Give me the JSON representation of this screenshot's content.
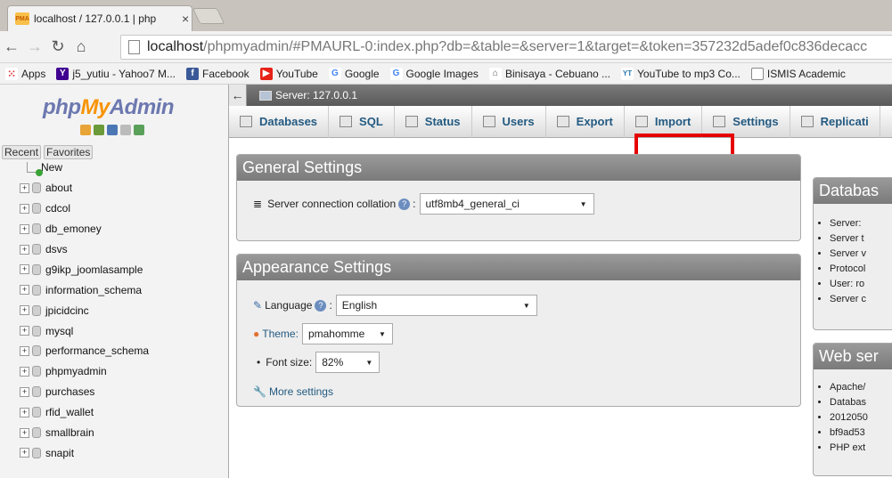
{
  "browser": {
    "tab_title": "localhost / 127.0.0.1 | php",
    "tab_close": "×",
    "url_host": "localhost",
    "url_path": "/phpmyadmin/#PMAURL-0:index.php?db=&table=&server=1&target=&token=357232d5adef0c836decacc",
    "bookmarks": [
      "Apps",
      "j5_yutiu - Yahoo7 M...",
      "Facebook",
      "YouTube",
      "Google",
      "Google Images",
      "Binisaya - Cebuano ...",
      "YouTube to mp3 Co...",
      "ISMIS Academic"
    ]
  },
  "sidebar": {
    "logo_php": "php",
    "logo_my": "My",
    "logo_admin": "Admin",
    "recent": "Recent",
    "favorites": "Favorites",
    "new_label": "New",
    "databases": [
      "about",
      "cdcol",
      "db_emoney",
      "dsvs",
      "g9ikp_joomlasample",
      "information_schema",
      "jpicidcinc",
      "mysql",
      "performance_schema",
      "phpmyadmin",
      "purchases",
      "rfid_wallet",
      "smallbrain",
      "snapit"
    ]
  },
  "main": {
    "server_label": "Server: 127.0.0.1",
    "tabs": [
      "Databases",
      "SQL",
      "Status",
      "Users",
      "Export",
      "Import",
      "Settings",
      "Replicati"
    ],
    "general": {
      "title": "General Settings",
      "collation_label": "Server connection collation",
      "collation_value": "utf8mb4_general_ci"
    },
    "appearance": {
      "title": "Appearance Settings",
      "language_label": "Language",
      "language_value": "English",
      "theme_label": "Theme:",
      "theme_value": "pmahomme",
      "fontsize_label": "Font size:",
      "fontsize_value": "82%",
      "more_settings": "More settings"
    },
    "database_server": {
      "title": "Databas",
      "items": [
        "Server:",
        "Server t",
        "Server v",
        "Protocol",
        "User: ro",
        "Server c"
      ]
    },
    "web_server": {
      "title": "Web ser",
      "items": [
        "Apache/",
        "Databas",
        "2012050",
        "bf9ad53",
        "PHP ext"
      ]
    }
  }
}
